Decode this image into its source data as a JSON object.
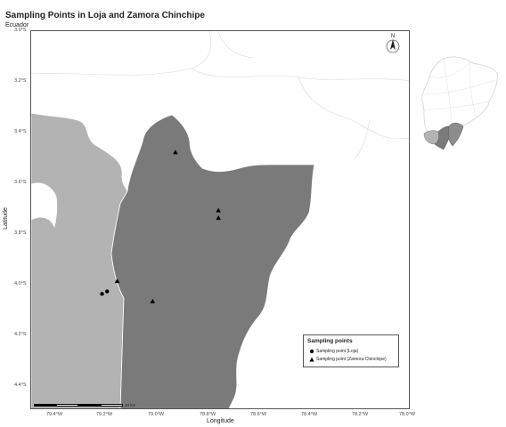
{
  "map": {
    "title": "Sampling Points in Loja and Zamora Chinchipe",
    "subtitle": "Ecuador",
    "x_axis_title": "Longitude",
    "y_axis_title": "Latitude",
    "y_ticks": [
      "3.0°S",
      "3.2°S",
      "3.4°S",
      "3.6°S",
      "3.8°S",
      "4.0°S",
      "4.2°S",
      "4.4°S"
    ],
    "x_ticks": [
      "79.4°W",
      "79.2°W",
      "79.0°W",
      "78.8°W",
      "78.6°W",
      "78.4°W",
      "78.2°W",
      "78.0°W"
    ],
    "north_label": "N",
    "scale_label": "40 km",
    "colors": {
      "loja": "#b3b3b3",
      "zamora": "#7a7a7a",
      "background": "#ffffff",
      "boundary": "#d9d9d9",
      "points": "#000000"
    }
  },
  "legend": {
    "title": "Sampling points",
    "items": [
      {
        "label": "Sampling point (Loja)",
        "symbol": "circle-icon"
      },
      {
        "label": "Sampling point (Zamora Chinchipe)",
        "symbol": "triangle-icon"
      }
    ]
  },
  "points": {
    "loja": [
      {
        "lon": -79.22,
        "lat": -4.04
      },
      {
        "lon": -79.2,
        "lat": -4.03
      }
    ],
    "zamora": [
      {
        "lon": -78.93,
        "lat": -3.48
      },
      {
        "lon": -78.76,
        "lat": -3.71
      },
      {
        "lon": -78.76,
        "lat": -3.74
      },
      {
        "lon": -79.16,
        "lat": -3.99
      },
      {
        "lon": -79.02,
        "lat": -4.07
      }
    ]
  }
}
